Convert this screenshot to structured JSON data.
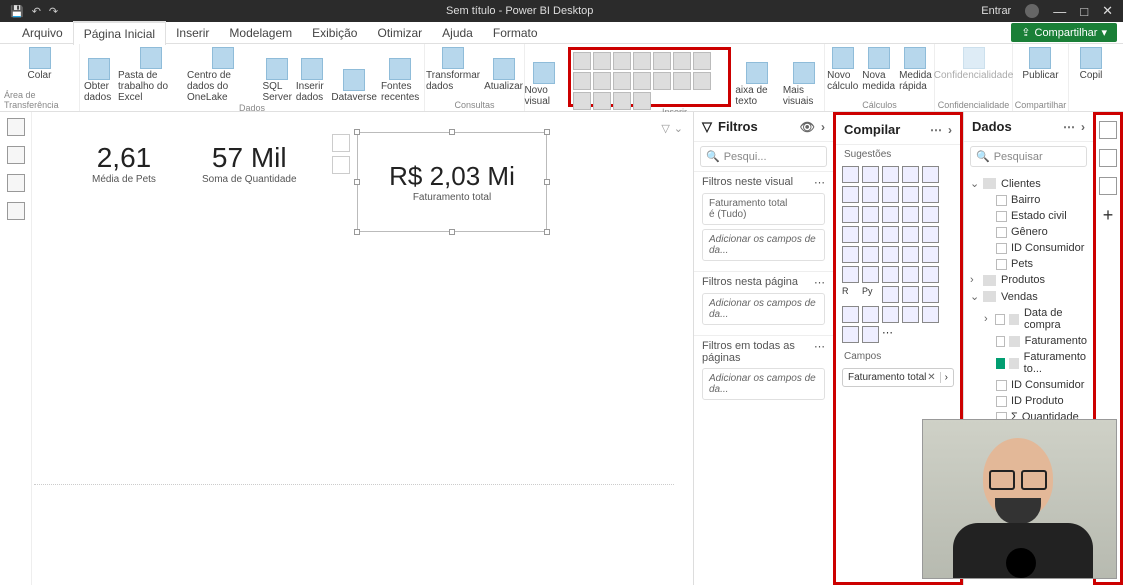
{
  "titlebar": {
    "title": "Sem título - Power BI Desktop",
    "login": "Entrar"
  },
  "menu": {
    "tabs": [
      "Arquivo",
      "Página Inicial",
      "Inserir",
      "Modelagem",
      "Exibição",
      "Otimizar",
      "Ajuda",
      "Formato"
    ],
    "active": 1,
    "share": "Compartilhar"
  },
  "ribbon": {
    "clipboard": {
      "label": "Área de Transferência",
      "paste": "Colar"
    },
    "data": {
      "label": "Dados",
      "items": [
        "Obter dados",
        "Pasta de trabalho do Excel",
        "Centro de dados do OneLake",
        "SQL Server",
        "Inserir dados",
        "Dataverse",
        "Fontes recentes"
      ]
    },
    "queries": {
      "label": "Consultas",
      "items": [
        "Transformar dados",
        "Atualizar"
      ]
    },
    "insert": {
      "label": "Inserir",
      "items": [
        "Novo visual",
        "aixa de texto",
        "Mais visuais"
      ]
    },
    "calc": {
      "label": "Cálculos",
      "items": [
        "Novo cálculo",
        "Nova medida",
        "Medida rápida"
      ]
    },
    "conf": {
      "label": "Confidencialidade",
      "item": "Confidencialidade"
    },
    "share": {
      "label": "Compartilhar",
      "item": "Publicar"
    },
    "copilot": "Copil"
  },
  "canvas": {
    "kpi1": {
      "value": "2,61",
      "label": "Média de Pets"
    },
    "kpi2": {
      "value": "57 Mil",
      "label": "Soma de Quantidade"
    },
    "kpi3": {
      "value": "R$ 2,03 Mi",
      "label": "Faturamento total"
    }
  },
  "filtros": {
    "title": "Filtros",
    "search": "Pesqui...",
    "sec_visual": "Filtros neste visual",
    "card_title": "Faturamento total",
    "card_sub": "é (Tudo)",
    "add": "Adicionar os campos de da...",
    "sec_page": "Filtros nesta página",
    "sec_all": "Filtros em todas as páginas"
  },
  "compilar": {
    "title": "Compilar",
    "suggestions": "Sugestões",
    "fields_label": "Campos",
    "field": "Faturamento total"
  },
  "dados": {
    "title": "Dados",
    "search": "Pesquisar",
    "tables": {
      "clientes": {
        "name": "Clientes",
        "cols": [
          "Bairro",
          "Estado civil",
          "Gênero",
          "ID Consumidor",
          "Pets"
        ]
      },
      "produtos": "Produtos",
      "vendas": {
        "name": "Vendas",
        "cols": [
          "Data de compra",
          "Faturamento",
          "Faturamento to...",
          "ID Consumidor",
          "ID Produto",
          "Quantidade"
        ],
        "checked": 2
      }
    }
  }
}
